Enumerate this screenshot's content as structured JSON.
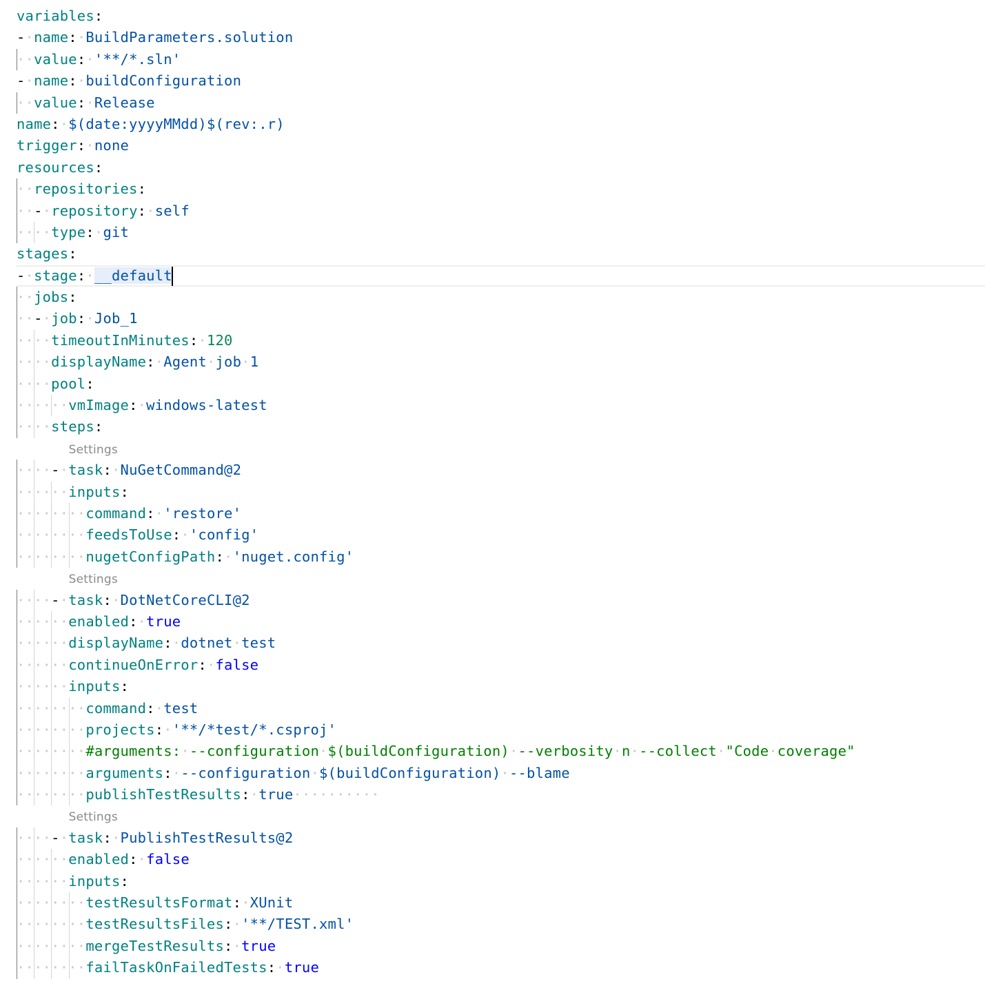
{
  "editor": {
    "language": "yaml",
    "colors": {
      "key": "#008080",
      "string": "#0451a5",
      "number": "#098658",
      "boolean": "#0000ff",
      "comment": "#008000",
      "codelens": "#8a8a8a"
    },
    "lines": [
      {
        "indent": 0,
        "dash": false,
        "key": "variables",
        "value": null,
        "type": null
      },
      {
        "indent": 0,
        "dash": true,
        "key": "name",
        "value": "BuildParameters.solution",
        "type": "str"
      },
      {
        "indent": 1,
        "dash": false,
        "key": "value",
        "value": "'**/*.sln'",
        "type": "str"
      },
      {
        "indent": 0,
        "dash": true,
        "key": "name",
        "value": "buildConfiguration",
        "type": "str"
      },
      {
        "indent": 1,
        "dash": false,
        "key": "value",
        "value": "Release",
        "type": "str"
      },
      {
        "indent": 0,
        "dash": false,
        "key": "name",
        "value": "$(date:yyyyMMdd)$(rev:.r)",
        "type": "str"
      },
      {
        "indent": 0,
        "dash": false,
        "key": "trigger",
        "value": "none",
        "type": "str"
      },
      {
        "indent": 0,
        "dash": false,
        "key": "resources",
        "value": null,
        "type": null
      },
      {
        "indent": 1,
        "dash": false,
        "key": "repositories",
        "value": null,
        "type": null
      },
      {
        "indent": 1,
        "dash": true,
        "key": "repository",
        "value": "self",
        "type": "str"
      },
      {
        "indent": 2,
        "dash": false,
        "key": "type",
        "value": "git",
        "type": "str"
      },
      {
        "indent": 0,
        "dash": false,
        "key": "stages",
        "value": null,
        "type": null
      },
      {
        "indent": 0,
        "dash": true,
        "key": "stage",
        "value": "__default",
        "type": "str",
        "current": true
      },
      {
        "indent": 1,
        "dash": false,
        "key": "jobs",
        "value": null,
        "type": null
      },
      {
        "indent": 1,
        "dash": true,
        "key": "job",
        "value": "Job_1",
        "type": "str"
      },
      {
        "indent": 2,
        "dash": false,
        "key": "timeoutInMinutes",
        "value": "120",
        "type": "num"
      },
      {
        "indent": 2,
        "dash": false,
        "key": "displayName",
        "value": "Agent job 1",
        "type": "str"
      },
      {
        "indent": 2,
        "dash": false,
        "key": "pool",
        "value": null,
        "type": null
      },
      {
        "indent": 3,
        "dash": false,
        "key": "vmImage",
        "value": "windows-latest",
        "type": "str"
      },
      {
        "indent": 2,
        "dash": false,
        "key": "steps",
        "value": null,
        "type": null
      },
      {
        "codelens": "Settings",
        "indent": 2
      },
      {
        "indent": 2,
        "dash": true,
        "key": "task",
        "value": "NuGetCommand@2",
        "type": "str"
      },
      {
        "indent": 3,
        "dash": false,
        "key": "inputs",
        "value": null,
        "type": null
      },
      {
        "indent": 4,
        "dash": false,
        "key": "command",
        "value": "'restore'",
        "type": "str"
      },
      {
        "indent": 4,
        "dash": false,
        "key": "feedsToUse",
        "value": "'config'",
        "type": "str"
      },
      {
        "indent": 4,
        "dash": false,
        "key": "nugetConfigPath",
        "value": "'nuget.config'",
        "type": "str"
      },
      {
        "codelens": "Settings",
        "indent": 2
      },
      {
        "indent": 2,
        "dash": true,
        "key": "task",
        "value": "DotNetCoreCLI@2",
        "type": "str"
      },
      {
        "indent": 3,
        "dash": false,
        "key": "enabled",
        "value": "true",
        "type": "bool"
      },
      {
        "indent": 3,
        "dash": false,
        "key": "displayName",
        "value": "dotnet test",
        "type": "str"
      },
      {
        "indent": 3,
        "dash": false,
        "key": "continueOnError",
        "value": "false",
        "type": "bool"
      },
      {
        "indent": 3,
        "dash": false,
        "key": "inputs",
        "value": null,
        "type": null
      },
      {
        "indent": 4,
        "dash": false,
        "key": "command",
        "value": "test",
        "type": "str"
      },
      {
        "indent": 4,
        "dash": false,
        "key": "projects",
        "value": "'**/*test/*.csproj'",
        "type": "str"
      },
      {
        "indent": 4,
        "comment": "#arguments: --configuration $(buildConfiguration) --verbosity n --collect \"Code coverage\""
      },
      {
        "indent": 4,
        "dash": false,
        "key": "arguments",
        "value": "--configuration $(buildConfiguration) --blame",
        "type": "str"
      },
      {
        "indent": 4,
        "dash": false,
        "key": "publishTestResults",
        "value": "true",
        "type": "str",
        "trailing_ws": 10
      },
      {
        "codelens": "Settings",
        "indent": 2
      },
      {
        "indent": 2,
        "dash": true,
        "key": "task",
        "value": "PublishTestResults@2",
        "type": "str"
      },
      {
        "indent": 3,
        "dash": false,
        "key": "enabled",
        "value": "false",
        "type": "bool"
      },
      {
        "indent": 3,
        "dash": false,
        "key": "inputs",
        "value": null,
        "type": null
      },
      {
        "indent": 4,
        "dash": false,
        "key": "testResultsFormat",
        "value": "XUnit",
        "type": "str"
      },
      {
        "indent": 4,
        "dash": false,
        "key": "testResultsFiles",
        "value": "'**/TEST.xml'",
        "type": "str"
      },
      {
        "indent": 4,
        "dash": false,
        "key": "mergeTestResults",
        "value": "true",
        "type": "bool"
      },
      {
        "indent": 4,
        "dash": false,
        "key": "failTaskOnFailedTests",
        "value": "true",
        "type": "bool"
      }
    ]
  }
}
